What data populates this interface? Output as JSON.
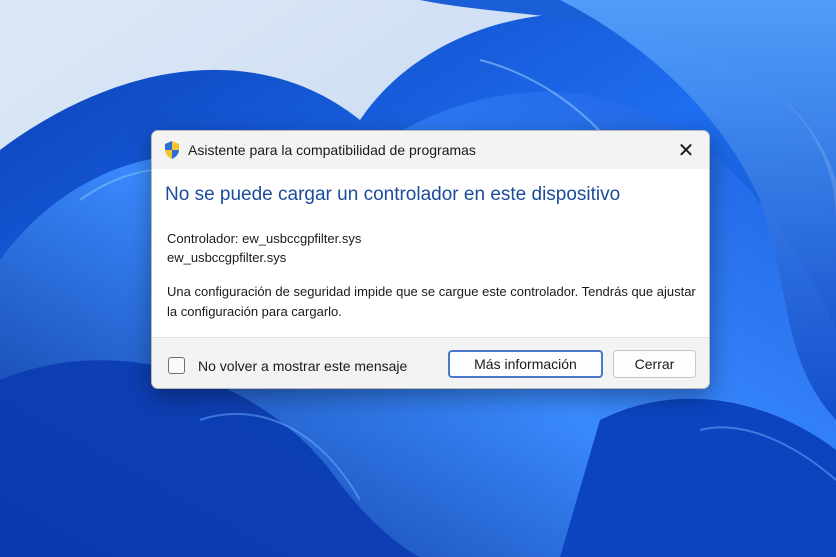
{
  "dialog": {
    "title": "Asistente para la compatibilidad de programas",
    "close_glyph": "✕",
    "heading": "No se puede cargar un controlador en este dispositivo",
    "driver_line1": "Controlador: ew_usbccgpfilter.sys",
    "driver_line2": "ew_usbccgpfilter.sys",
    "message": "Una configuración de seguridad impide que se cargue este controlador. Tendrás que ajustar la configuración para cargarlo.",
    "checkbox_label": "No volver a mostrar este mensaje",
    "more_info_button": "Más información",
    "close_button": "Cerrar"
  },
  "icons": {
    "title": "shield-icon",
    "close": "close-icon"
  },
  "colors": {
    "heading": "#1b4c9c",
    "accent": "#4a78c8",
    "wallpaper": "#1a5fd8"
  }
}
